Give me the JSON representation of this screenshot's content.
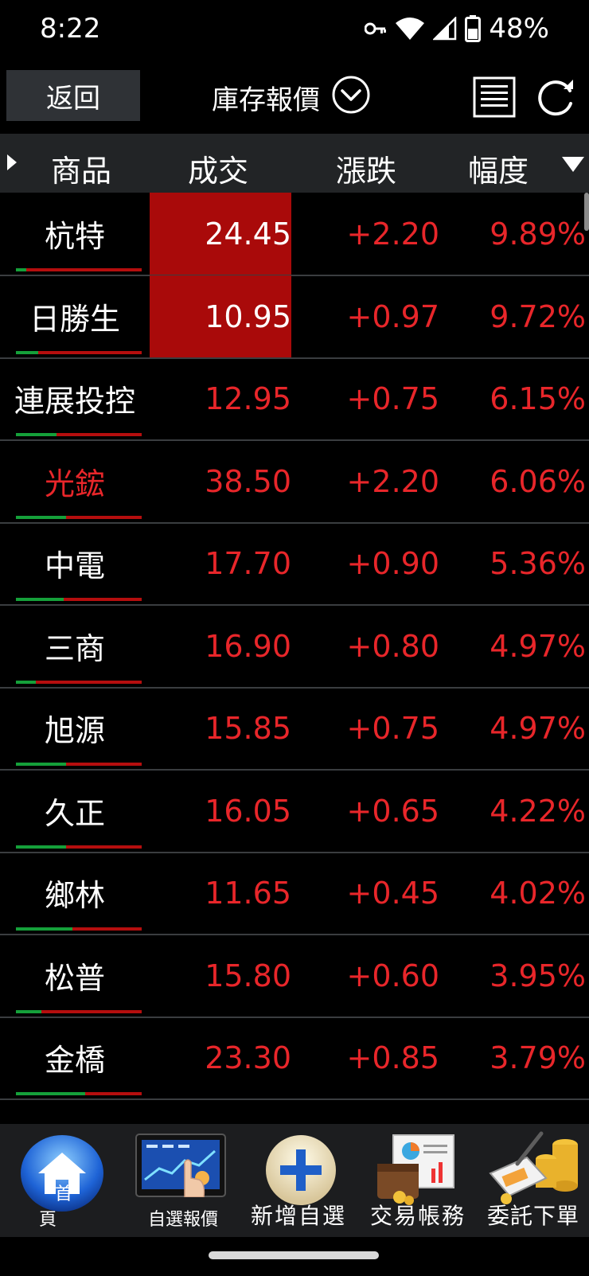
{
  "status": {
    "time": "8:22",
    "battery": "48%"
  },
  "header": {
    "back_label": "返回",
    "title": "庫存報價"
  },
  "columns": [
    "商品",
    "成交",
    "漲跌",
    "幅度"
  ],
  "rows": [
    {
      "name": "杭特",
      "price": "24.45",
      "change": "+2.20",
      "pct": "9.89%",
      "limit_up": true,
      "name_red": false,
      "green_frac": 0.08
    },
    {
      "name": "日勝生",
      "price": "10.95",
      "change": "+0.97",
      "pct": "9.72%",
      "limit_up": true,
      "name_red": false,
      "green_frac": 0.18
    },
    {
      "name": "連展投控",
      "price": "12.95",
      "change": "+0.75",
      "pct": "6.15%",
      "limit_up": false,
      "name_red": false,
      "green_frac": 0.32
    },
    {
      "name": "光鋐",
      "price": "38.50",
      "change": "+2.20",
      "pct": "6.06%",
      "limit_up": false,
      "name_red": true,
      "green_frac": 0.4
    },
    {
      "name": "中電",
      "price": "17.70",
      "change": "+0.90",
      "pct": "5.36%",
      "limit_up": false,
      "name_red": false,
      "green_frac": 0.38
    },
    {
      "name": "三商",
      "price": "16.90",
      "change": "+0.80",
      "pct": "4.97%",
      "limit_up": false,
      "name_red": false,
      "green_frac": 0.16
    },
    {
      "name": "旭源",
      "price": "15.85",
      "change": "+0.75",
      "pct": "4.97%",
      "limit_up": false,
      "name_red": false,
      "green_frac": 0.4
    },
    {
      "name": "久正",
      "price": "16.05",
      "change": "+0.65",
      "pct": "4.22%",
      "limit_up": false,
      "name_red": false,
      "green_frac": 0.4
    },
    {
      "name": "鄉林",
      "price": "11.65",
      "change": "+0.45",
      "pct": "4.02%",
      "limit_up": false,
      "name_red": false,
      "green_frac": 0.45
    },
    {
      "name": "松普",
      "price": "15.80",
      "change": "+0.60",
      "pct": "3.95%",
      "limit_up": false,
      "name_red": false,
      "green_frac": 0.2
    },
    {
      "name": "金橋",
      "price": "23.30",
      "change": "+0.85",
      "pct": "3.79%",
      "limit_up": false,
      "name_red": false,
      "green_frac": 0.55
    }
  ],
  "nav": {
    "home": "首頁",
    "watchlist": "自選報價",
    "add_watch": "新增自選",
    "account": "交易帳務",
    "order": "委託下單"
  },
  "colors": {
    "up_red": "#e8262a",
    "limit_bg": "#a90a0a",
    "bar_green": "#15a03a",
    "bar_red": "#b50e0e"
  }
}
